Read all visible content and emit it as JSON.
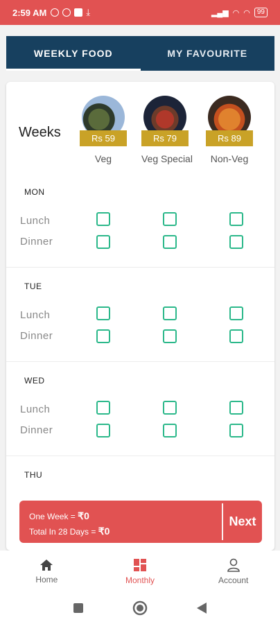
{
  "status_bar": {
    "time": "2:59 AM",
    "battery": "99"
  },
  "tabs": [
    {
      "label": "WEEKLY FOOD"
    },
    {
      "label": "MY FAVOURITE"
    }
  ],
  "header": {
    "weeks_label": "Weeks"
  },
  "plans": [
    {
      "name": "Veg",
      "price": "Rs 59"
    },
    {
      "name": "Veg Special",
      "price": "Rs 79"
    },
    {
      "name": "Non-Veg",
      "price": "Rs 89"
    }
  ],
  "days": [
    {
      "name": "MON",
      "meals": [
        "Lunch",
        "Dinner"
      ]
    },
    {
      "name": "TUE",
      "meals": [
        "Lunch",
        "Dinner"
      ]
    },
    {
      "name": "WED",
      "meals": [
        "Lunch",
        "Dinner"
      ]
    },
    {
      "name": "THU",
      "meals": []
    }
  ],
  "summary": {
    "one_week_label": "One Week = ",
    "one_week_value": "₹0",
    "total_label": "Total In 28 Days = ",
    "total_value": "₹0",
    "next_label": "Next"
  },
  "bottom_nav": [
    {
      "label": "Home",
      "icon": "home-icon"
    },
    {
      "label": "Monthly",
      "icon": "grid-icon"
    },
    {
      "label": "Account",
      "icon": "user-icon"
    }
  ],
  "colors": {
    "accent": "#e15252",
    "tab_bg": "#17405f",
    "checkbox": "#2bb88a",
    "price_badge": "#c9a227"
  }
}
